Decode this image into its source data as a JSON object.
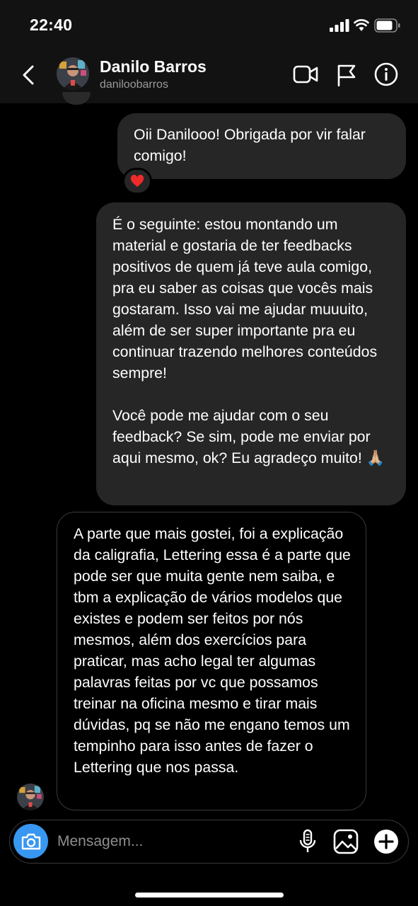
{
  "status_bar": {
    "time": "22:40"
  },
  "header": {
    "name": "Danilo Barros",
    "username": "daniloobarros"
  },
  "messages": [
    {
      "from": "me",
      "text": "Oii Danilooo! Obrigada por vir falar comigo!",
      "reaction": "heart"
    },
    {
      "from": "me",
      "paragraphs": [
        "É o seguinte: estou montando um material e gostaria de ter feedbacks positivos de quem já teve aula comigo, pra eu saber as coisas que vocês mais gostaram. Isso vai me ajudar muuuito, além de ser super importante pra eu continuar trazendo melhores conteúdos sempre!",
        "Você pode me ajudar com o seu feedback? Se sim, pode me enviar por aqui mesmo, ok? Eu agradeço muito! 🙏🏼"
      ]
    },
    {
      "from": "them",
      "text": "A parte que mais gostei, foi a explicação da caligrafia, Lettering essa é a parte que pode ser que muita gente nem saiba, e tbm a explicação de vários modelos que existes e podem ser feitos por nós mesmos, além dos exercícios para praticar, mas acho legal ter algumas palavras feitas por vc que possamos treinar na oficina mesmo e tirar mais dúvidas, pq se não me engano temos um tempinho para isso antes de fazer o Lettering que nos passa."
    }
  ],
  "composer": {
    "placeholder": "Mensagem..."
  },
  "icons": [
    "back-icon",
    "video-call-icon",
    "flag-icon",
    "info-icon",
    "camera-icon",
    "microphone-icon",
    "gallery-icon",
    "plus-icon",
    "heart-icon"
  ],
  "colors": {
    "camera_button": "#3897f0",
    "outgoing_bubble": "#262626",
    "heart": "#ed2b2b"
  }
}
